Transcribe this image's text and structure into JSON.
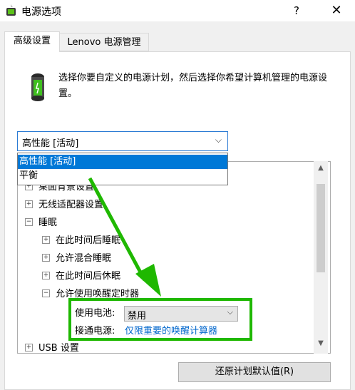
{
  "window": {
    "title": "电源选项",
    "help": "?",
    "close": "✕"
  },
  "tabs": [
    {
      "label": "高级设置"
    },
    {
      "label": "Lenovo 电源管理"
    }
  ],
  "intro": "选择你要自定义的电源计划，然后选择你希望计算机管理的电源设置。",
  "plan_select": {
    "value": "高性能 [活动]",
    "options": [
      "高性能 [活动]",
      "平衡"
    ]
  },
  "tree": {
    "r0": "桌面背景设置",
    "r1": "无线适配器设置",
    "r2": "睡眠",
    "r3": "在此时间后睡眠",
    "r4": "允许混合睡眠",
    "r5": "在此时间后休眠",
    "r6": "允许使用唤醒定时器",
    "battery_label": "使用电池:",
    "battery_value": "禁用",
    "plugged_label": "接通电源:",
    "plugged_value": "仅限重要的唤醒计算器",
    "r9": "USB 设置"
  },
  "restore_button": "还原计划默认值(R)",
  "colors": {
    "highlight": "#1fb800",
    "selection": "#0078d7",
    "link": "#0066cc"
  }
}
